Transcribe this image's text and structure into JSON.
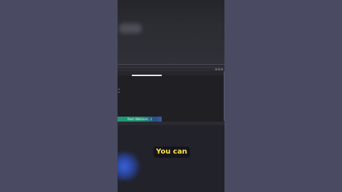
{
  "editor": {
    "title": "",
    "toolbar_label": "",
    "filter_placeholder": "",
    "status_text": ""
  },
  "tag": {
    "label": "Rosh Webinar(...)"
  },
  "caption": {
    "text": "You can"
  },
  "colors": {
    "page_bg": "#4a4a62",
    "tag_green": "#1f9a78",
    "caption_text": "#ffe74a",
    "glow_blue": "#3a63d6"
  }
}
